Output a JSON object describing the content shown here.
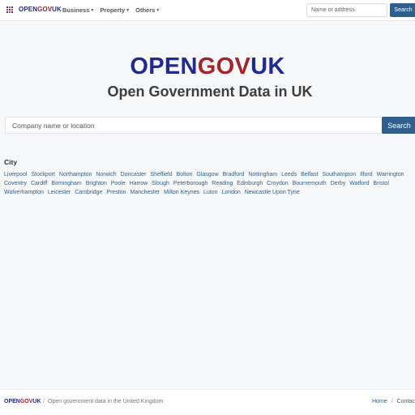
{
  "header": {
    "brand": {
      "part1": "OPEN",
      "part2": "GOV",
      "part3": "UK"
    },
    "menu": [
      {
        "label": "Business"
      },
      {
        "label": "Property"
      },
      {
        "label": "Others"
      }
    ],
    "search": {
      "placeholder": "Name or address",
      "button_label": "Search"
    }
  },
  "hero": {
    "logo": {
      "part1": "OPEN",
      "part2": "GOV",
      "part3": "UK"
    },
    "tagline": "Open Government Data in UK",
    "search": {
      "placeholder": "Company name or location",
      "button_label": "Search"
    }
  },
  "cities": {
    "heading": "City",
    "items": [
      "Liverpool",
      "Stockport",
      "Northampton",
      "Norwich",
      "Doncaster",
      "Sheffield",
      "Bolton",
      "Glasgow",
      "Bradford",
      "Nottingham",
      "Leeds",
      "Belfast",
      "Southampton",
      "Ilford",
      "Warrington",
      "Coventry",
      "Cardiff",
      "Birmingham",
      "Brighton",
      "Poole",
      "Harrow",
      "Slough",
      "Peterborough",
      "Reading",
      "Edinburgh",
      "Croydon",
      "Bournemouth",
      "Derby",
      "Watford",
      "Bristol",
      "Wolverhampton",
      "Leicester",
      "Cambridge",
      "Preston",
      "Manchester",
      "Milton Keynes",
      "Luton",
      "London",
      "Newcastle Upon Tyne"
    ]
  },
  "footer": {
    "brand": {
      "part1": "OPEN",
      "part2": "GOV",
      "part3": "UK"
    },
    "separator": "/",
    "description": "Open government data in the United Kingdom",
    "links": {
      "home": "Home",
      "separator": "/",
      "contact": "Contac"
    }
  },
  "colors": {
    "brand_blue": "#202a8f",
    "brand_red": "#a5232a",
    "accent": "#2f5f8a",
    "grid_icon": [
      "#2b3d8f",
      "#d33b3b",
      "#2b3d8f",
      "#d33b3b",
      "#2b3d8f",
      "#d33b3b",
      "#2b3d8f",
      "#d33b3b",
      "#2b3d8f"
    ]
  },
  "icons": {
    "app_menu": "grid-dots-icon",
    "dropdown": "caret-down-icon"
  }
}
